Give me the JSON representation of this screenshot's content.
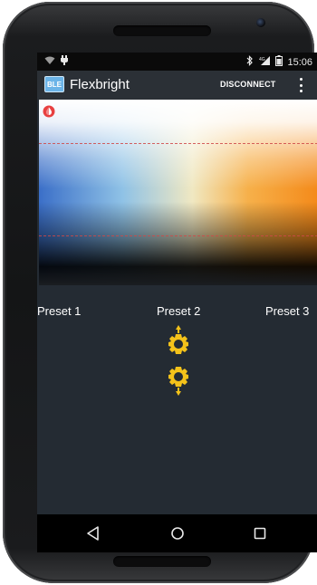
{
  "status_bar": {
    "time": "15:06",
    "left_icons": [
      "wifi-icon",
      "notification-icon"
    ],
    "right_icons": [
      "bluetooth-icon",
      "signal-4g-icon",
      "battery-icon"
    ],
    "network_label": "4G"
  },
  "action_bar": {
    "app_icon_text": "BLE",
    "title": "Flexbright",
    "disconnect_label": "DISCONNECT",
    "overflow_icon": "more-vert-icon"
  },
  "picker": {
    "icon": "color-drop-icon",
    "accent_color": "#e84040",
    "gradient_colors": [
      "#3b6fc8",
      "#8fc2e6",
      "#f0e8c2",
      "#f6b04a",
      "#f48a1a"
    ]
  },
  "presets": [
    {
      "label": "Preset 1"
    },
    {
      "label": "Preset 2"
    },
    {
      "label": "Preset 3"
    }
  ],
  "brightness": {
    "up_icon": "brightness-up-icon",
    "down_icon": "brightness-down-icon",
    "color": "#f4c21a"
  },
  "nav_bar": {
    "back_icon": "back-icon",
    "home_icon": "home-icon",
    "recents_icon": "recents-icon"
  }
}
